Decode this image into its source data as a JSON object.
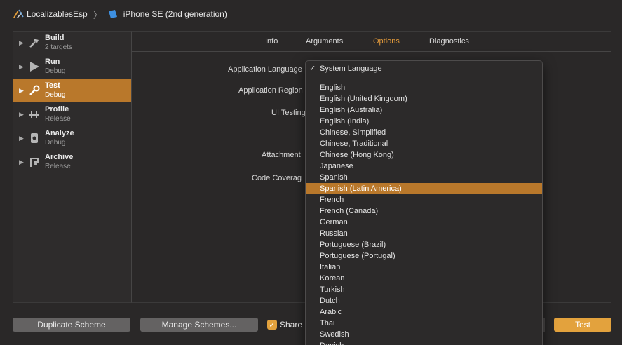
{
  "breadcrumb": {
    "project": "LocalizablesEsp",
    "device": "iPhone SE (2nd generation)"
  },
  "sidebar": {
    "items": [
      {
        "name": "Build",
        "sub": "2 targets",
        "icon": "hammer-icon"
      },
      {
        "name": "Run",
        "sub": "Debug",
        "icon": "play-icon"
      },
      {
        "name": "Test",
        "sub": "Debug",
        "icon": "wrench-icon",
        "active": true
      },
      {
        "name": "Profile",
        "sub": "Release",
        "icon": "gauge-icon"
      },
      {
        "name": "Analyze",
        "sub": "Debug",
        "icon": "analyze-icon"
      },
      {
        "name": "Archive",
        "sub": "Release",
        "icon": "archive-icon"
      }
    ]
  },
  "tabs": [
    "Info",
    "Arguments",
    "Options",
    "Diagnostics"
  ],
  "active_tab": "Options",
  "form": {
    "app_language": "Application Language",
    "app_region": "Application Region",
    "ui_testing": "UI Testing",
    "attachments": "Attachment",
    "code_coverage": "Code Coverag"
  },
  "menu": {
    "checked": "System Language",
    "options": [
      "English",
      "English (United Kingdom)",
      "English (Australia)",
      "English (India)",
      "Chinese, Simplified",
      "Chinese, Traditional",
      "Chinese (Hong Kong)",
      "Japanese",
      "Spanish",
      "Spanish (Latin America)",
      "French",
      "French (Canada)",
      "German",
      "Russian",
      "Portuguese (Brazil)",
      "Portuguese (Portugal)",
      "Italian",
      "Korean",
      "Turkish",
      "Dutch",
      "Arabic",
      "Thai",
      "Swedish",
      "Danish"
    ],
    "highlighted": "Spanish (Latin America)"
  },
  "bottom": {
    "duplicate": "Duplicate Scheme",
    "manage": "Manage Schemes...",
    "share": "Share",
    "test": "Test"
  },
  "colors": {
    "accent": "#e39a3b",
    "selection": "#b9782b"
  }
}
